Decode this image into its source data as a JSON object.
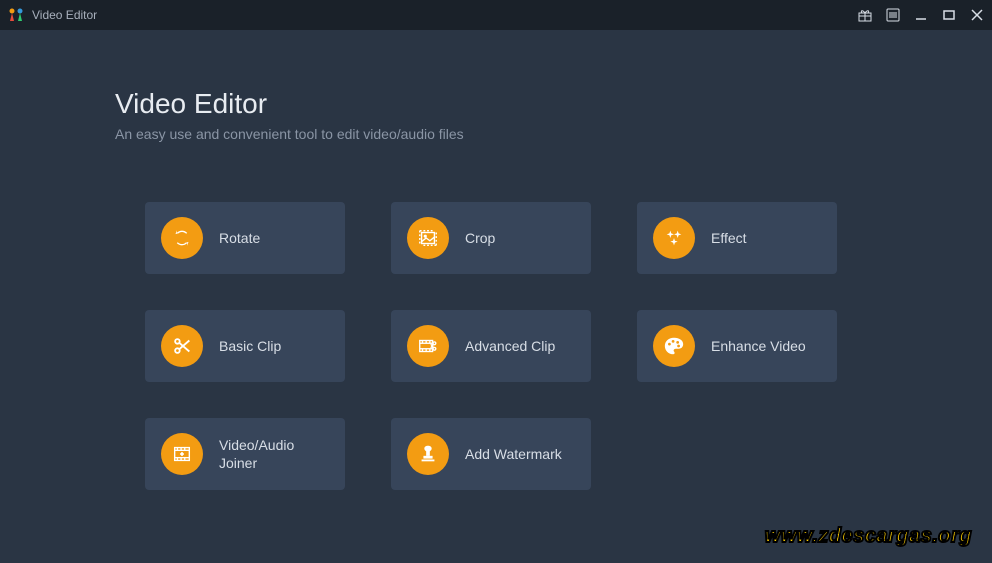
{
  "titlebar": {
    "title": "Video Editor"
  },
  "header": {
    "title": "Video Editor",
    "subtitle": "An easy use and convenient tool to edit video/audio files"
  },
  "tools": {
    "rotate": {
      "label": "Rotate",
      "icon": "rotate-icon"
    },
    "crop": {
      "label": "Crop",
      "icon": "crop-icon"
    },
    "effect": {
      "label": "Effect",
      "icon": "effect-icon"
    },
    "basic_clip": {
      "label": "Basic Clip",
      "icon": "scissors-icon"
    },
    "advanced_clip": {
      "label": "Advanced Clip",
      "icon": "film-scissors-icon"
    },
    "enhance_video": {
      "label": "Enhance Video",
      "icon": "palette-icon"
    },
    "joiner": {
      "label": "Video/Audio Joiner",
      "icon": "film-joiner-icon"
    },
    "watermark": {
      "label": "Add Watermark",
      "icon": "stamp-icon"
    }
  },
  "colors": {
    "accent": "#f39c12",
    "bg": "#2a3544",
    "card": "#37455a",
    "titlebar": "#1a2129"
  },
  "watermark_url": "www.zdescargas.org"
}
